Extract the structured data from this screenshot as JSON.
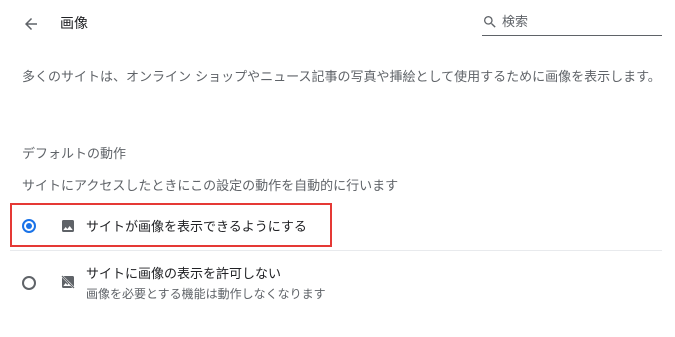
{
  "header": {
    "title": "画像",
    "back_icon": "arrow-back-icon",
    "search": {
      "placeholder": "検索",
      "value": "",
      "icon": "search-icon"
    }
  },
  "description": "多くのサイトは、オンライン ショップやニュース記事の写真や挿絵として使用するために画像を表示します。",
  "default_behavior": {
    "heading": "デフォルトの動作",
    "subheading": "サイトにアクセスしたときにこの設定の動作を自動的に行います",
    "options": [
      {
        "label": "サイトが画像を表示できるようにする",
        "sublabel": "",
        "selected": true,
        "icon": "image-icon"
      },
      {
        "label": "サイトに画像の表示を許可しない",
        "sublabel": "画像を必要とする機能は動作しなくなります",
        "selected": false,
        "icon": "image-off-icon"
      }
    ]
  },
  "colors": {
    "accent": "#1a73e8",
    "highlight": "#e53935",
    "text_primary": "#202124",
    "text_secondary": "#5f6368"
  }
}
